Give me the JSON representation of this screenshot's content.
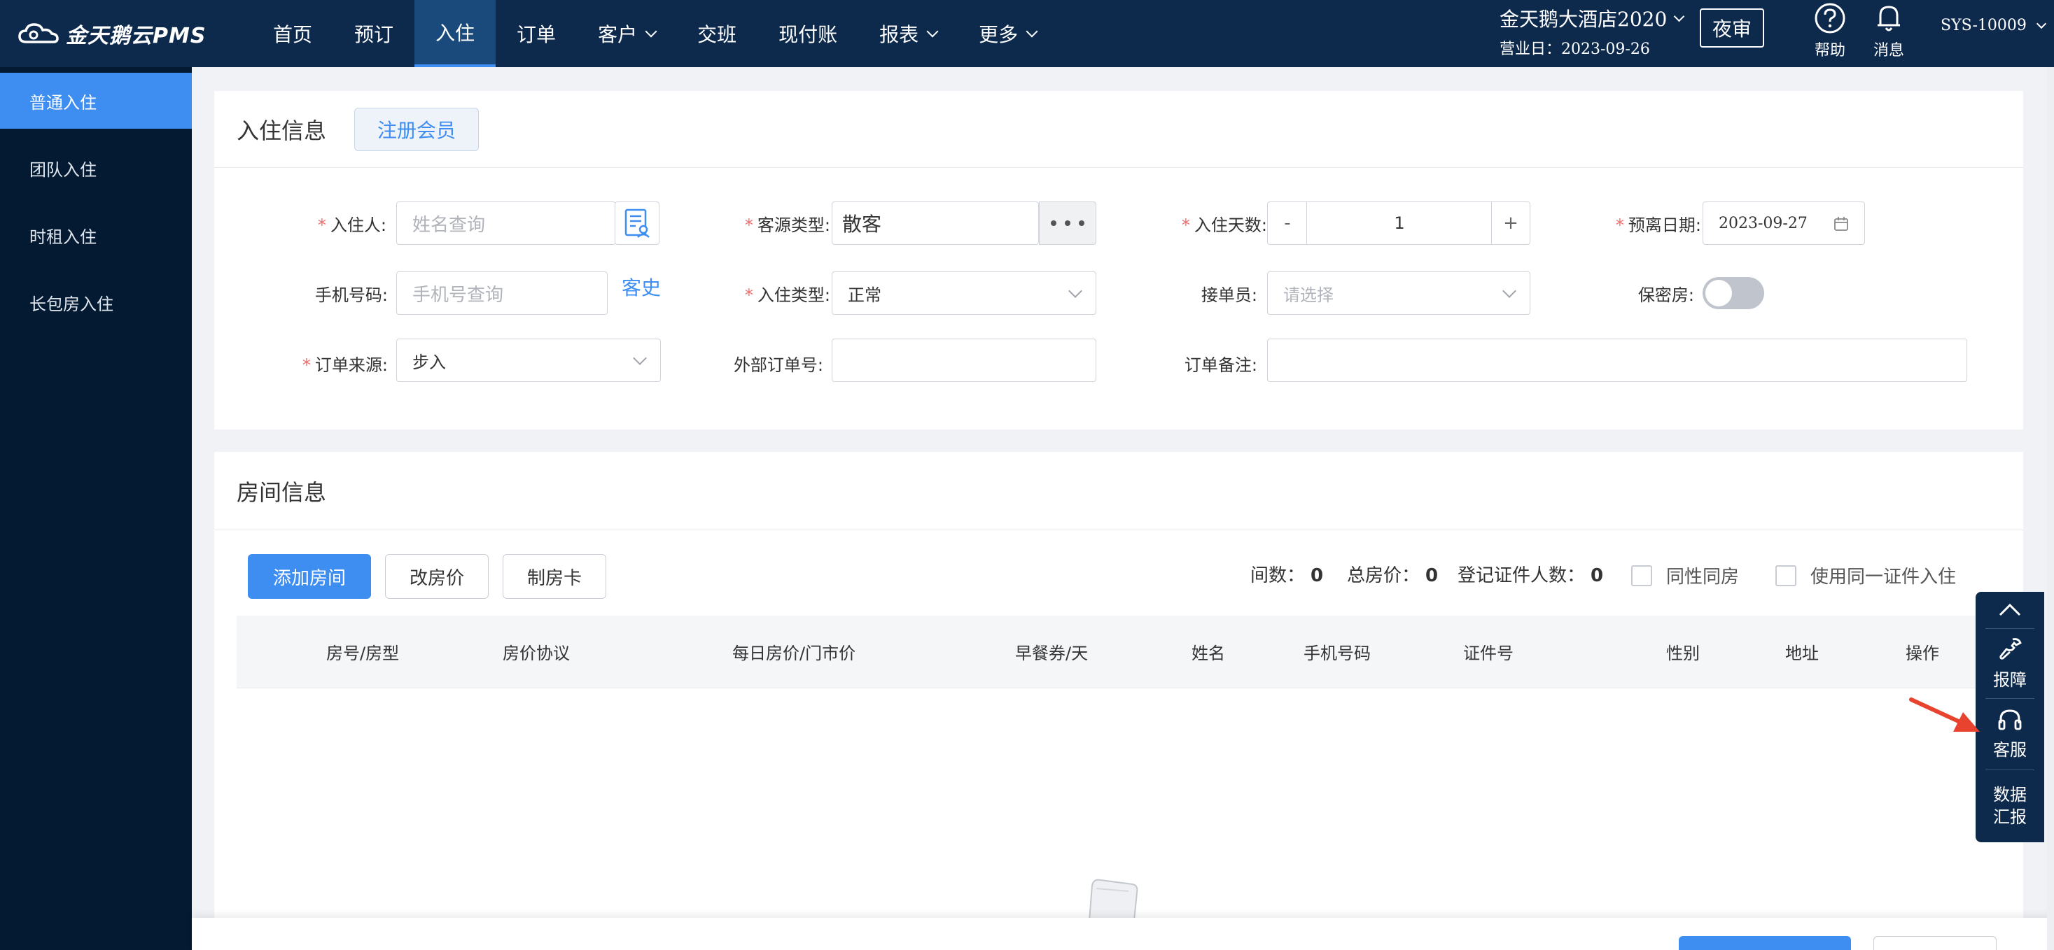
{
  "brand": {
    "name": "金天鹅云PMS"
  },
  "nav": {
    "items": [
      {
        "label": "首页",
        "dropdown": false,
        "active": false
      },
      {
        "label": "预订",
        "dropdown": false,
        "active": false
      },
      {
        "label": "入住",
        "dropdown": false,
        "active": true
      },
      {
        "label": "订单",
        "dropdown": false,
        "active": false
      },
      {
        "label": "客户",
        "dropdown": true,
        "active": false
      },
      {
        "label": "交班",
        "dropdown": false,
        "active": false
      },
      {
        "label": "现付账",
        "dropdown": false,
        "active": false
      },
      {
        "label": "报表",
        "dropdown": true,
        "active": false
      },
      {
        "label": "更多",
        "dropdown": true,
        "active": false
      }
    ]
  },
  "header": {
    "hotel_name": "金天鹅大酒店2020",
    "business_date": "营业日：2023-09-26",
    "night_audit": "夜审",
    "help": "帮助",
    "messages": "消息",
    "user": "SYS-10009"
  },
  "sidebar": {
    "items": [
      {
        "label": "普通入住",
        "active": true
      },
      {
        "label": "团队入住",
        "active": false
      },
      {
        "label": "时租入住",
        "active": false
      },
      {
        "label": "长包房入住",
        "active": false
      }
    ]
  },
  "checkin_info": {
    "title": "入住信息",
    "register_member": "注册会员",
    "guest": {
      "label": "入住人:",
      "placeholder": "姓名查询"
    },
    "source_type": {
      "label": "客源类型:",
      "value": "散客"
    },
    "nights": {
      "label": "入住天数:",
      "value": "1",
      "minus": "-",
      "plus": "+"
    },
    "departure": {
      "label": "预离日期:",
      "value": "2023-09-27"
    },
    "phone": {
      "label": "手机号码:",
      "placeholder": "手机号查询",
      "history": "客史"
    },
    "checkin_type": {
      "label": "入住类型:",
      "value": "正常"
    },
    "receiver": {
      "label": "接单员:",
      "placeholder": "请选择"
    },
    "secret_room": {
      "label": "保密房:",
      "on": false
    },
    "order_source": {
      "label": "订单来源:",
      "value": "步入"
    },
    "external_order": {
      "label": "外部订单号:",
      "value": ""
    },
    "order_note": {
      "label": "订单备注:",
      "value": ""
    }
  },
  "room_info": {
    "title": "房间信息",
    "add_room": "添加房间",
    "change_price": "改房价",
    "make_card": "制房卡",
    "rooms_label": "间数：",
    "rooms_count": "0",
    "total_label": "总房价：",
    "total_price": "0",
    "id_label": "登记证件人数：",
    "id_count": "0",
    "same_gender": "同性同房",
    "same_id": "使用同一证件入住",
    "columns": [
      "房号/房型",
      "房价协议",
      "每日房价/门市价",
      "早餐券/天",
      "姓名",
      "手机号码",
      "证件号",
      "性别",
      "地址",
      "操作"
    ]
  },
  "float_panel": {
    "report_fault": "报障",
    "customer_service": "客服",
    "data_report_1": "数据",
    "data_report_2": "汇报"
  },
  "colors": {
    "topbar": "#0d2a4d",
    "sidebar": "#041a33",
    "accent": "#3d8ef0",
    "required": "#f56c6c",
    "annotation_arrow": "#e8432e"
  }
}
